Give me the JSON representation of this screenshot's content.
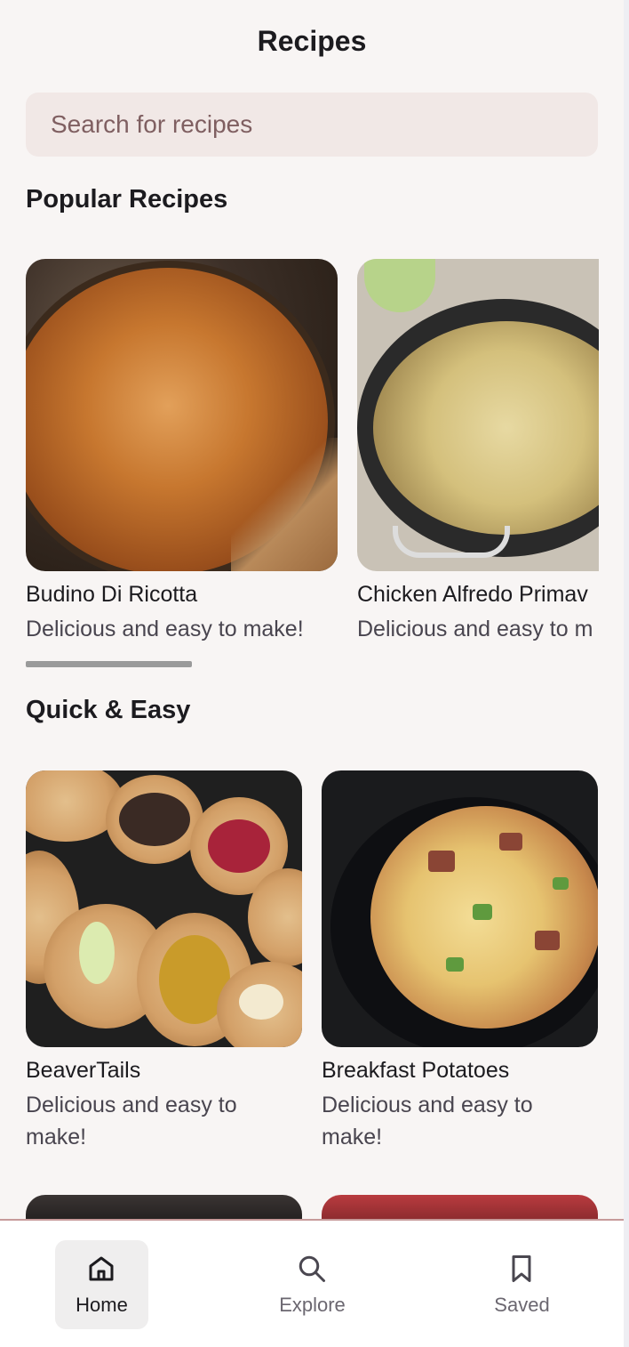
{
  "app": {
    "title": "Recipes"
  },
  "search": {
    "placeholder": "Search for recipes"
  },
  "sections": {
    "popular": {
      "title": "Popular Recipes",
      "cards": [
        {
          "name": "Budino Di Ricotta",
          "description": "Delicious and easy to make!"
        },
        {
          "name": "Chicken Alfredo Primav",
          "description": "Delicious and easy to m"
        }
      ]
    },
    "quick": {
      "title": "Quick & Easy",
      "cards": [
        {
          "name": "BeaverTails",
          "description": "Delicious and easy to make!"
        },
        {
          "name": "Breakfast Potatoes",
          "description": "Delicious and easy to make!"
        }
      ]
    }
  },
  "nav": {
    "items": [
      {
        "label": "Home",
        "icon": "home-icon",
        "active": true
      },
      {
        "label": "Explore",
        "icon": "search-icon",
        "active": false
      },
      {
        "label": "Saved",
        "icon": "bookmark-icon",
        "active": false
      }
    ]
  },
  "colors": {
    "background": "#f8f5f4",
    "search_bg": "#f1e8e6",
    "placeholder": "#7f5f61",
    "nav_active_bg": "#efeeee"
  }
}
